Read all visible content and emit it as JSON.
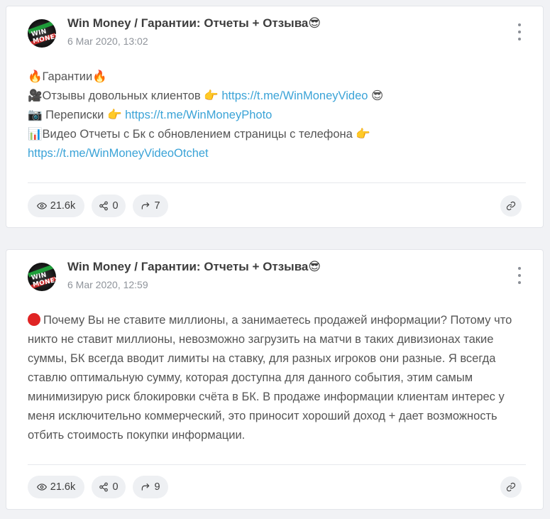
{
  "posts": [
    {
      "channel_title": "Win Money / Гарантии: Отчеты + Отзыва😎",
      "date": "6 Mar 2020, 13:02",
      "avatar_text": "WIN MONEY",
      "lines": [
        {
          "prefix": "🔥Гарантии🔥",
          "link": "",
          "suffix": ""
        },
        {
          "prefix": "🎥Отзывы довольных клиентов 👉 ",
          "link": "https://t.me/WinMoneyVideo",
          "suffix": " 😎"
        },
        {
          "prefix": "📷 Переписки 👉 ",
          "link": "https://t.me/WinMoneyPhoto",
          "suffix": ""
        },
        {
          "prefix": "📊Видео Отчеты с Бк с обновлением страницы с телефона 👉",
          "link": "",
          "suffix": ""
        },
        {
          "prefix": "",
          "link": "https://t.me/WinMoneyVideoOtchet",
          "suffix": ""
        }
      ],
      "views": "21.6k",
      "shares": "0",
      "forwards": "7"
    },
    {
      "channel_title": "Win Money / Гарантии: Отчеты + Отзыва😎",
      "date": "6 Mar 2020, 12:59",
      "avatar_text": "WIN MONEY",
      "text": "Почему Вы не ставите миллионы, а занимаетесь продажей информации? Потому что никто не ставит миллионы, невозможно загрузить на матчи в таких дивизионах такие суммы, БК всегда вводит лимиты на ставку, для разных игроков они разные. Я всегда ставлю оптимальную сумму, которая доступна для данного события, этим самым минимизирую риск блокировки счёта в БК. В продаже информации клиентам интерес у меня исключительно коммерческий, это приносит хороший доход + дает возможность отбить стоимость покупки информации.",
      "views": "21.6k",
      "shares": "0",
      "forwards": "9"
    }
  ],
  "colors": {
    "link": "#3aa3d7",
    "pill_bg": "#eef0f3",
    "red_dot": "#e02424"
  },
  "icons": [
    "eye-icon",
    "share-icon",
    "forward-icon",
    "link-icon",
    "more-vertical-icon"
  ]
}
